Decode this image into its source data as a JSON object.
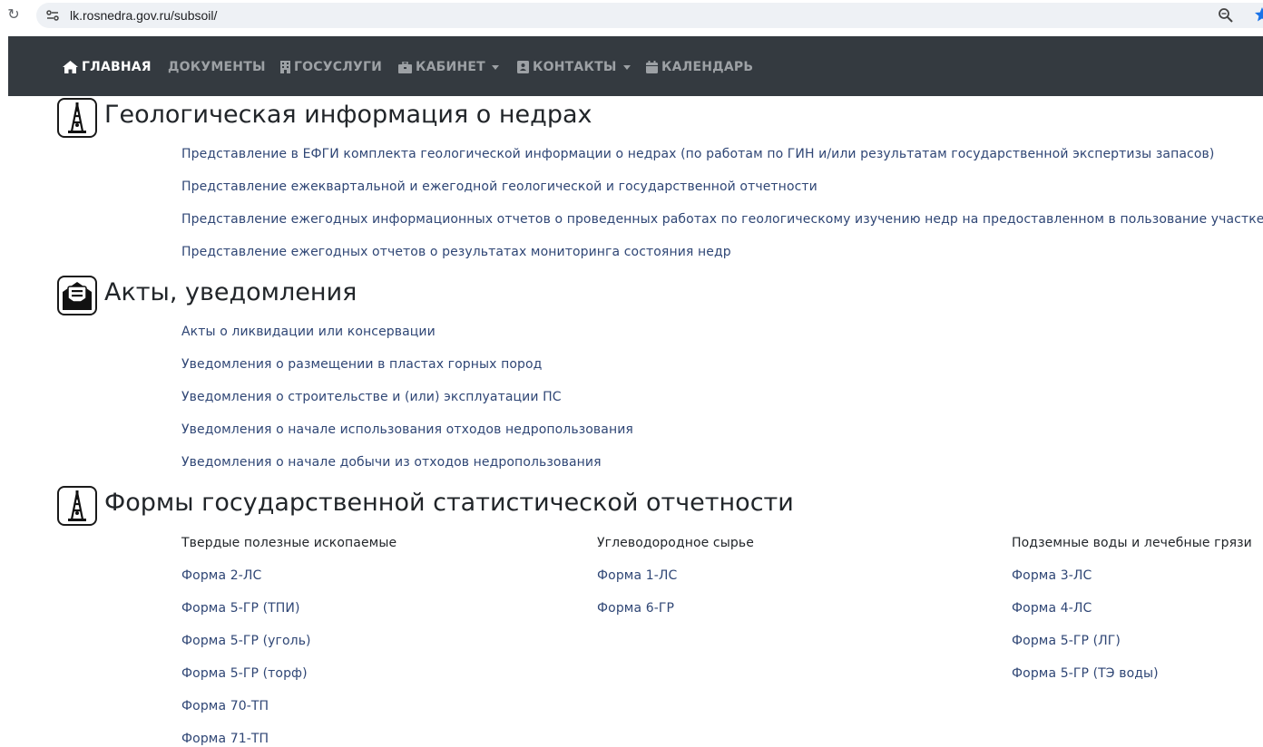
{
  "browser": {
    "url": "lk.rosnedra.gov.ru/subsoil/"
  },
  "nav": {
    "items": [
      {
        "label": "ГЛАВНАЯ",
        "icon": "home-icon",
        "active": true
      },
      {
        "label": "ДОКУМЕНТЫ"
      },
      {
        "label": "ГОСУСЛУГИ",
        "icon": "building-icon"
      },
      {
        "label": "КАБИНЕТ",
        "icon": "briefcase-icon",
        "dropdown": true
      },
      {
        "label": "КОНТАКТЫ",
        "icon": "contact-card-icon",
        "dropdown": true
      },
      {
        "label": "КАЛЕНДАРЬ",
        "icon": "calendar-icon"
      }
    ]
  },
  "sections": [
    {
      "title": "Геологическая информация о недрах",
      "icon": "drilling-rig-icon",
      "links": [
        "Представление в ЕФГИ комплекта геологической информации о недрах (по работам по ГИН и/или результатам государственной экспертизы запасов)",
        "Представление ежеквартальной и ежегодной геологической и государственной отчетности",
        "Представление ежегодных информационных отчетов о проведенных работах по геологическому изучению недр на предоставленном в пользование участке недр",
        "Представление ежегодных отчетов о результатах мониторинга состояния недр"
      ]
    },
    {
      "title": "Акты, уведомления",
      "icon": "envelope-open-icon",
      "links": [
        "Акты о ликвидации или консервации",
        "Уведомления о размещении в пластах горных пород",
        "Уведомления о строительстве и (или) эксплуатации ПС",
        "Уведомления о начале использования отходов недропользования",
        "Уведомления о начале добычи из отходов недропользования"
      ]
    },
    {
      "title": "Формы государственной статистической отчетности",
      "icon": "drilling-rig-icon",
      "columns": [
        {
          "heading": "Твердые полезные ископаемые",
          "links": [
            "Форма 2-ЛС",
            "Форма 5-ГР (ТПИ)",
            "Форма 5-ГР (уголь)",
            "Форма 5-ГР (торф)",
            "Форма 70-ТП",
            "Форма 71-ТП"
          ]
        },
        {
          "heading": "Углеводородное сырье",
          "links": [
            "Форма 1-ЛС",
            "Форма 6-ГР"
          ]
        },
        {
          "heading": "Подземные воды и лечебные грязи",
          "links": [
            "Форма 3-ЛС",
            "Форма 4-ЛС",
            "Форма 5-ГР (ЛГ)",
            "Форма 5-ГР (ТЭ воды)"
          ]
        }
      ]
    }
  ],
  "colors": {
    "navbar_bg": "#343a40",
    "nav_text": "#9da1a5",
    "nav_active": "#ffffff",
    "link": "#2f4675",
    "heading": "#212529"
  }
}
